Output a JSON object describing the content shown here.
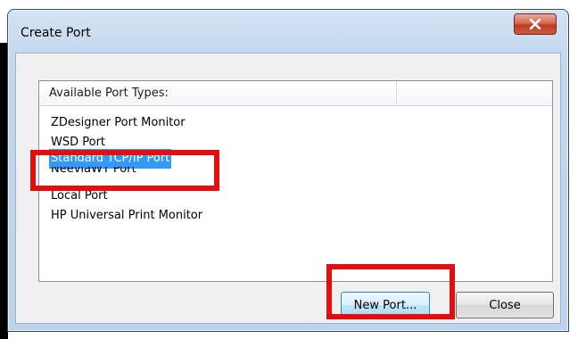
{
  "window": {
    "title": "Create Port",
    "close_icon": "close-x-icon",
    "accent": "#3399ff",
    "close_color": "#c13b1f"
  },
  "port_list": {
    "column_header": "Available Port Types:",
    "items": [
      {
        "label": "ZDesigner Port Monitor"
      },
      {
        "label": "WSD Port"
      },
      {
        "label": "Standard TCP/IP Port",
        "selected": true
      },
      {
        "label": "NeeviaWT Port"
      },
      {
        "label": "Local Port"
      },
      {
        "label": "HP Universal Print Monitor"
      }
    ]
  },
  "buttons": {
    "new_port": "New Port...",
    "close": "Close"
  },
  "annotation": {
    "color": "#e01010"
  }
}
